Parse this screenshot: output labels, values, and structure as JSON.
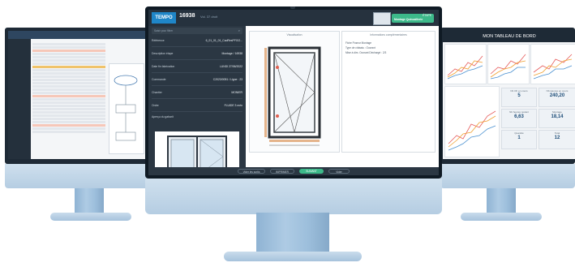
{
  "center": {
    "brand": "TEMPO",
    "doc_number": "16938",
    "doc_sub": "Vol. 37 droit",
    "status": "Montage Quincaillerie",
    "status_top": "ÉTAPE",
    "sidebar_search_placeholder": "Saisir pour filtrer",
    "fields": [
      {
        "label": "Référence",
        "value": "6_01_01_01_CadResPFGO..."
      },
      {
        "label": "Description étape",
        "value": "Montage / 16938"
      },
      {
        "label": "Date fin fabrication",
        "value": "LUNDI 27/06/2022"
      },
      {
        "label": "Commande",
        "value": "C2023/0051 / Ligne : 23"
      },
      {
        "label": "Chantier",
        "value": "MONIER"
      },
      {
        "label": "Ordre",
        "value": "FLUIDE 3 mén"
      },
      {
        "label": "Aperçu du gabarit",
        "value": ""
      }
    ],
    "drawing_title": "Visualisation",
    "info_title": "Informations complémentaires",
    "info_lines": [
      "Fiche Poseur Montage",
      "Type de châssis : Ouvrant",
      "Mise à dim. Ouvrant Déchargé : 2/3"
    ],
    "buttons": [
      "Vider les sortis",
      "IMPRIMER",
      "SUIVANT",
      "Vider"
    ]
  },
  "right": {
    "title": "MON TABLEAU DE BORD",
    "kpis": [
      {
        "label": "Nb OF en cours",
        "value": "5"
      },
      {
        "label": "Nb Heures en cours",
        "value": "240,20"
      },
      {
        "label": "Nb heures restant",
        "value": "6,63"
      },
      {
        "label": "Montage",
        "value": "18,14"
      },
      {
        "label": "Quantité",
        "value": "1"
      },
      {
        "label": "Total",
        "value": "12"
      }
    ]
  },
  "colors": {
    "accent_green": "#3db98a",
    "brand_blue": "#1f86c8",
    "dark_panel": "#2b3743"
  }
}
